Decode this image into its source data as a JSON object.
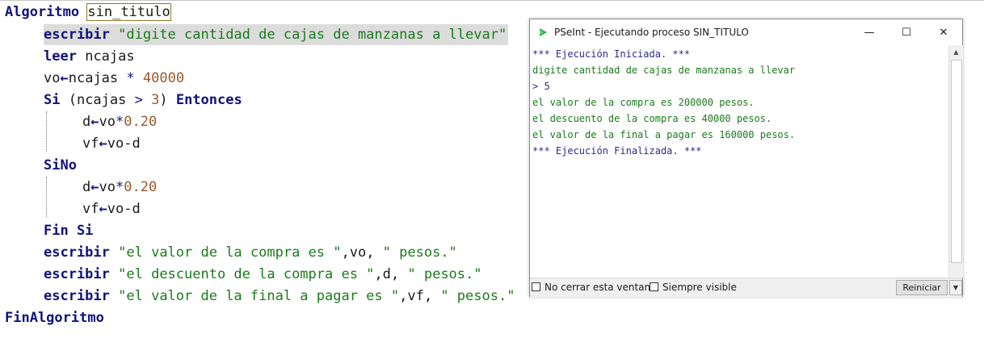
{
  "editor": {
    "lines": {
      "l1": {
        "kw": "Algoritmo",
        "name": "sin_titulo"
      },
      "l2": {
        "kw": "escribir",
        "str": "\"digite cantidad de cajas de manzanas a llevar\""
      },
      "l3": {
        "kw": "leer",
        "rest": "ncajas"
      },
      "l4": {
        "a": "vo",
        "arrow": "←",
        "b": "ncajas",
        "op": " * ",
        "num": "40000"
      },
      "l5": {
        "kw": "Si",
        "mid1": " (ncajas ",
        "op": ">",
        "num": " 3",
        "mid2": ") ",
        "kw2": "Entonces"
      },
      "l6": {
        "a": "d",
        "arrow": "←",
        "b": "vo",
        "op": "*",
        "num": "0.20"
      },
      "l7": {
        "a": "vf",
        "arrow": "←",
        "b": "vo-d"
      },
      "l8": {
        "kw": "SiNo"
      },
      "l9": {
        "a": "d",
        "arrow": "←",
        "b": "vo",
        "op": "*",
        "num": "0.20"
      },
      "l10": {
        "a": "vf",
        "arrow": "←",
        "b": "vo-d"
      },
      "l11": {
        "kw": "Fin Si"
      },
      "l12": {
        "kw": "escribir",
        "s1": "\"el valor de la compra es \"",
        "m": ",vo, ",
        "s2": "\" pesos.\""
      },
      "l13": {
        "kw": "escribir",
        "s1": "\"el descuento de la compra es \"",
        "m": ",d, ",
        "s2": "\" pesos.\""
      },
      "l14": {
        "kw": "escribir",
        "s1": "\"el valor de la final a pagar es \"",
        "m": ",vf, ",
        "s2": "\" pesos.\""
      },
      "l15": {
        "kw": "FinAlgoritmo"
      }
    }
  },
  "console_window": {
    "title": "PSeInt - Ejecutando proceso SIN_TITULO",
    "minimize": "—",
    "maximize": "☐",
    "close": "✕",
    "lines": [
      "*** Ejecución Iniciada. ***",
      "digite cantidad de cajas de manzanas a llevar",
      "> 5",
      "el valor de la compra es 200000 pesos.",
      "el descuento de la compra es 40000 pesos.",
      "el valor de la final a pagar es 160000 pesos.",
      "*** Ejecución Finalizada. ***"
    ],
    "no_close_label": "No cerrar esta ventana",
    "always_visible_label": "Siempre visible",
    "restart_label": "Reiniciar",
    "scroll_up": "▲",
    "scroll_down": "▼",
    "icon": "pseint-logo-icon"
  },
  "colors": {
    "keyword": "#12127a",
    "string": "#1b7a1b",
    "number": "#9c5a2c",
    "highlight": "#dcdcdc"
  }
}
